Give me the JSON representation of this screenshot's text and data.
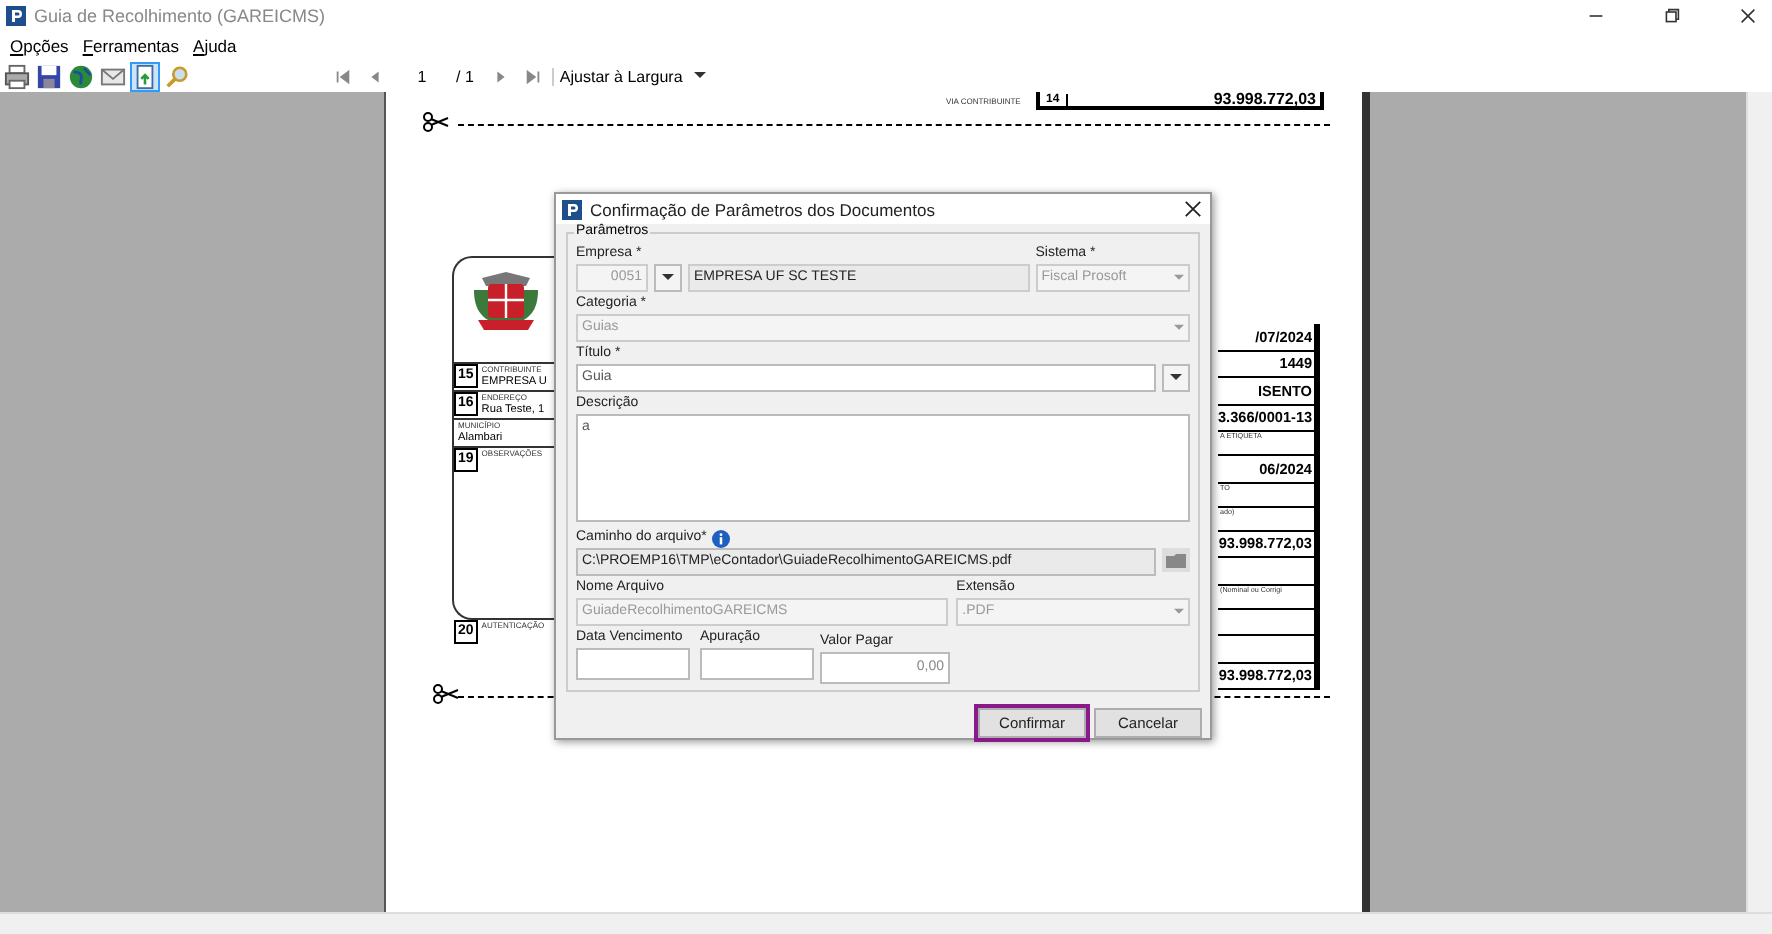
{
  "window": {
    "title": "Guia de Recolhimento (GAREICMS)"
  },
  "menu": [
    {
      "label": "Opções"
    },
    {
      "label": "Ferramentas"
    },
    {
      "label": "Ajuda"
    }
  ],
  "toolbar": {
    "page": "1",
    "page_total": "/ 1",
    "zoom": "Ajustar à Largura"
  },
  "document": {
    "via_label": "VIA CONTRIBUINTE",
    "top_number": "14",
    "top_value": "93.998.772,03",
    "left_rows": [
      {
        "number": "15",
        "label": "CONTRIBUINTE",
        "value": "EMPRESA U"
      },
      {
        "number": "16",
        "label": "ENDEREÇO",
        "value": "Rua Teste, 1"
      },
      {
        "label": "MUNICÍPIO",
        "value": "Alambari"
      },
      {
        "number": "19",
        "label": "OBSERVAÇÕES"
      }
    ],
    "auth_number": "20",
    "auth_label": "AUTENTICAÇÃO",
    "right_cells": [
      {
        "kind": "value",
        "text": "/07/2024"
      },
      {
        "kind": "value",
        "text": "1449"
      },
      {
        "kind": "value",
        "text": "ISENTO"
      },
      {
        "kind": "value",
        "text": "3.366/0001-13"
      },
      {
        "kind": "label",
        "text": "A ETIQUETA"
      },
      {
        "kind": "value",
        "text": "06/2024"
      },
      {
        "kind": "label",
        "text": "TO"
      },
      {
        "kind": "label",
        "text": "ado)"
      },
      {
        "kind": "value",
        "text": "93.998.772,03"
      },
      {
        "kind": "blank"
      },
      {
        "kind": "label",
        "text": "(Nominal ou Corrigi"
      },
      {
        "kind": "blank"
      },
      {
        "kind": "blank"
      },
      {
        "kind": "value",
        "text": "93.998.772,03"
      }
    ]
  },
  "dialog": {
    "title": "Confirmação de Parâmetros dos Documentos",
    "group": "Parâmetros",
    "empresa": {
      "label": "Empresa *",
      "code": "0051",
      "name": "EMPRESA UF SC TESTE",
      "disabled": true
    },
    "sistema": {
      "label": "Sistema *",
      "value": "Fiscal Prosoft",
      "disabled": true
    },
    "categoria": {
      "label": "Categoria *",
      "value": "Guias",
      "disabled": true
    },
    "titulo": {
      "label": "Título *",
      "value": "Guia",
      "disabled": false
    },
    "descricao": {
      "label": "Descrição",
      "value": "a"
    },
    "caminho": {
      "label": "Caminho do arquivo*",
      "value": "C:\\PROEMP16\\TMP\\eContador\\GuiadeRecolhimentoGAREICMS.pdf"
    },
    "nome_arquivo": {
      "label": "Nome Arquivo",
      "value": "GuiadeRecolhimentoGAREICMS",
      "disabled": true
    },
    "extensao": {
      "label": "Extensão",
      "value": ".PDF",
      "disabled": true
    },
    "data_vencimento": {
      "label": "Data Vencimento"
    },
    "apuracao": {
      "label": "Apuração"
    },
    "valor_pagar": {
      "label": "Valor Pagar",
      "value": "0,00"
    },
    "buttons": [
      {
        "label": "Confirmar",
        "focused": true
      },
      {
        "label": "Cancelar",
        "focused": false
      }
    ]
  }
}
